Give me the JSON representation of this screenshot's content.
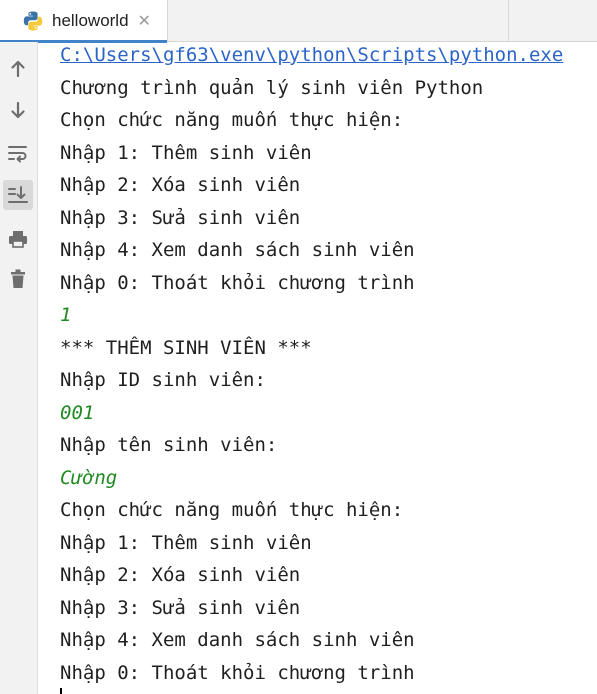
{
  "tab": {
    "title": "helloworld",
    "close_glyph": "✕",
    "icon": "python-icon"
  },
  "toolbar": {
    "items": [
      {
        "name": "up-arrow-icon",
        "label": "Up"
      },
      {
        "name": "down-arrow-icon",
        "label": "Down"
      },
      {
        "name": "soft-wrap-icon",
        "label": "Soft wrap"
      },
      {
        "name": "scroll-to-end-icon",
        "label": "Scroll to end",
        "active": true
      },
      {
        "name": "print-icon",
        "label": "Print"
      },
      {
        "name": "trash-icon",
        "label": "Clear"
      }
    ]
  },
  "console": {
    "lines": [
      {
        "text": "C:\\Users\\gf63\\venv\\python\\Scripts\\python.exe",
        "kind": "path"
      },
      {
        "text": "Chương trình quản lý sinh viên Python",
        "kind": "output"
      },
      {
        "text": "Chọn chức năng muốn thực hiện:",
        "kind": "output"
      },
      {
        "text": "Nhập 1: Thêm sinh viên",
        "kind": "output"
      },
      {
        "text": "Nhập 2: Xóa sinh viên",
        "kind": "output"
      },
      {
        "text": "Nhập 3: Sửa sinh viên",
        "kind": "output"
      },
      {
        "text": "Nhập 4: Xem danh sách sinh viên",
        "kind": "output"
      },
      {
        "text": "Nhập 0: Thoát khỏi chương trình",
        "kind": "output"
      },
      {
        "text": "1",
        "kind": "input"
      },
      {
        "text": "*** THÊM SINH VIÊN ***",
        "kind": "output"
      },
      {
        "text": "Nhập ID sinh viên:",
        "kind": "output"
      },
      {
        "text": "001",
        "kind": "input"
      },
      {
        "text": "Nhập tên sinh viên:",
        "kind": "output"
      },
      {
        "text": "Cường",
        "kind": "input"
      },
      {
        "text": "Chọn chức năng muốn thực hiện:",
        "kind": "output"
      },
      {
        "text": "Nhập 1: Thêm sinh viên",
        "kind": "output"
      },
      {
        "text": "Nhập 2: Xóa sinh viên",
        "kind": "output"
      },
      {
        "text": "Nhập 3: Sửa sinh viên",
        "kind": "output"
      },
      {
        "text": "Nhập 4: Xem danh sách sinh viên",
        "kind": "output"
      },
      {
        "text": "Nhập 0: Thoát khỏi chương trình",
        "kind": "output"
      }
    ]
  },
  "colors": {
    "accent": "#4083c9",
    "path_link": "#2a64c8",
    "user_input": "#1f8a1f",
    "output_text": "#1f1f1f"
  }
}
